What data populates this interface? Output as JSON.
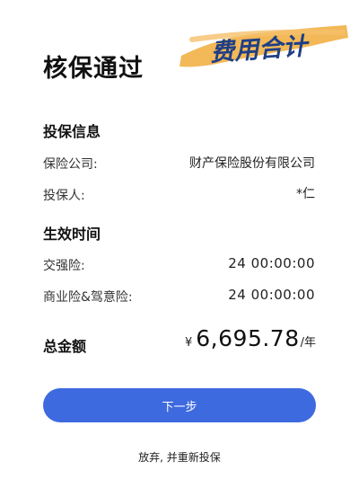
{
  "page": {
    "title": "核保通过",
    "sticker_text": "费用合计"
  },
  "policy_info": {
    "heading": "投保信息",
    "insurer_label": "保险公司:",
    "insurer_value": "财产保险股份有限公司",
    "applicant_label": "投保人:",
    "applicant_value": "*仁"
  },
  "effective_time": {
    "heading": "生效时间",
    "compulsory_label": "交强险:",
    "compulsory_value": "24 00:00:00",
    "commercial_label": "商业险&驾意险:",
    "commercial_value": "24 00:00:00"
  },
  "total": {
    "label": "总金额",
    "currency": "¥",
    "amount": "6,695.78",
    "unit": "/年"
  },
  "actions": {
    "next_label": "下一步",
    "abandon_label": "放弃, 并重新投保"
  },
  "colors": {
    "primary_button": "#3e6ae0",
    "sticker_highlight": "#f2b24a",
    "sticker_text": "#1f3f86"
  }
}
